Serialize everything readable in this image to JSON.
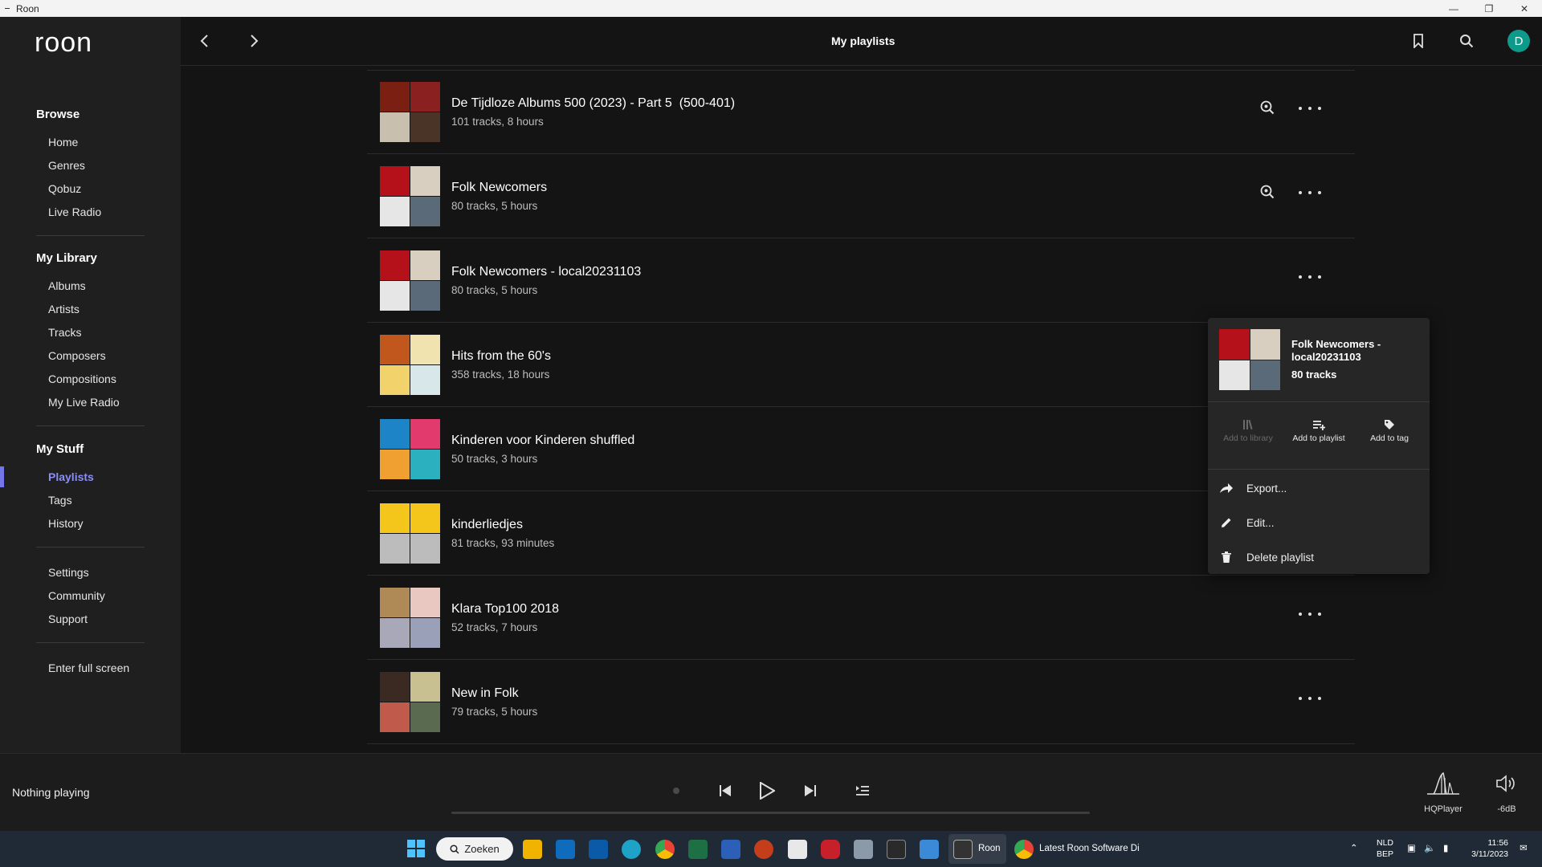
{
  "window": {
    "title": "Roon"
  },
  "sidebar": {
    "logo": "roon",
    "browse": {
      "heading": "Browse",
      "items": [
        "Home",
        "Genres",
        "Qobuz",
        "Live Radio"
      ]
    },
    "library": {
      "heading": "My Library",
      "items": [
        "Albums",
        "Artists",
        "Tracks",
        "Composers",
        "Compositions",
        "My Live Radio"
      ]
    },
    "stuff": {
      "heading": "My Stuff",
      "items": [
        "Playlists",
        "Tags",
        "History"
      ],
      "active": "Playlists"
    },
    "misc": [
      "Settings",
      "Community",
      "Support"
    ],
    "fullscreen": "Enter full screen"
  },
  "header": {
    "title": "My playlists",
    "avatar_letter": "D"
  },
  "playlists": [
    {
      "title": "De Tijdloze Albums 500 (2023) - Part 5  (500-401)",
      "subtitle": "101 tracks, 8 hours",
      "has_focus_icon": true,
      "colors": [
        "#7a1f12",
        "#8a2020",
        "#c9bfae",
        "#4a3428"
      ]
    },
    {
      "title": "Folk Newcomers",
      "subtitle": "80 tracks, 5 hours",
      "has_focus_icon": true,
      "colors": [
        "#b5111a",
        "#d8cfc0",
        "#e6e6e6",
        "#5a6a78"
      ]
    },
    {
      "title": "Folk Newcomers - local20231103",
      "subtitle": "80 tracks, 5 hours",
      "has_focus_icon": false,
      "colors": [
        "#b5111a",
        "#d8cfc0",
        "#e6e6e6",
        "#5a6a78"
      ]
    },
    {
      "title": "Hits from the 60's",
      "subtitle": "358 tracks, 18 hours",
      "has_focus_icon": false,
      "colors": [
        "#c2571e",
        "#f0e3b0",
        "#f2d36b",
        "#d8e8ea"
      ]
    },
    {
      "title": "Kinderen voor Kinderen shuffled",
      "subtitle": "50 tracks, 3 hours",
      "has_focus_icon": false,
      "colors": [
        "#1e84c8",
        "#e23a6c",
        "#f0a030",
        "#2bb0c0"
      ]
    },
    {
      "title": "kinderliedjes",
      "subtitle": "81 tracks, 93 minutes",
      "has_focus_icon": false,
      "colors": [
        "#f4c51a",
        "#f4c51a",
        "#bcbcbc",
        "#bcbcbc"
      ]
    },
    {
      "title": "Klara Top100 2018",
      "subtitle": "52 tracks, 7 hours",
      "has_focus_icon": false,
      "colors": [
        "#b08a56",
        "#e8c8c0",
        "#a8a8b8",
        "#9aa0b8"
      ]
    },
    {
      "title": "New in Folk",
      "subtitle": "79 tracks, 5 hours",
      "has_focus_icon": false,
      "colors": [
        "#3a2a22",
        "#c8c090",
        "#c05a4a",
        "#5a6a50"
      ]
    }
  ],
  "context_menu": {
    "title": "Folk Newcomers - local20231103",
    "subtitle": "80 tracks",
    "actions": [
      {
        "label": "Add to library",
        "enabled": false,
        "icon": "library-icon"
      },
      {
        "label": "Add to playlist",
        "enabled": true,
        "icon": "playlist-add-icon"
      },
      {
        "label": "Add to tag",
        "enabled": true,
        "icon": "tag-icon"
      }
    ],
    "items": [
      {
        "label": "Export...",
        "icon": "share-arrow-icon"
      },
      {
        "label": "Edit...",
        "icon": "pencil-icon"
      },
      {
        "label": "Delete playlist",
        "icon": "trash-icon"
      }
    ]
  },
  "player": {
    "now_playing": "Nothing playing",
    "zone": "HQPlayer",
    "volume": "-6dB"
  },
  "taskbar": {
    "search_label": "Zoeken",
    "roon_label": "Roon",
    "chrome_label": "Latest Roon Software Di",
    "lang_top": "NLD",
    "lang_bottom": "BEP",
    "time": "11:56",
    "date": "3/11/2023"
  },
  "colors": {
    "accent": "#7375e8",
    "avatar": "#0d9a8a"
  }
}
